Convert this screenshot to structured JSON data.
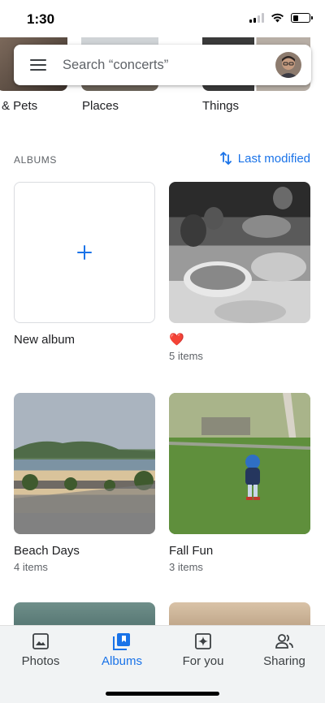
{
  "status": {
    "time": "1:30"
  },
  "search": {
    "placeholder": "Search “concerts”"
  },
  "categories": [
    {
      "label": "& Pets"
    },
    {
      "label": "Places"
    },
    {
      "label": "Things"
    }
  ],
  "albums_section": {
    "heading": "ALBUMS",
    "sort_label": "Last modified"
  },
  "albums": [
    {
      "title": "New album",
      "count": ""
    },
    {
      "title": "❤️",
      "count": "5 items"
    },
    {
      "title": "Beach Days",
      "count": "4 items"
    },
    {
      "title": "Fall Fun",
      "count": "3 items"
    }
  ],
  "nav": [
    {
      "label": "Photos",
      "icon": "photo-icon"
    },
    {
      "label": "Albums",
      "icon": "albums-icon"
    },
    {
      "label": "For you",
      "icon": "sparkle-icon"
    },
    {
      "label": "Sharing",
      "icon": "people-icon"
    }
  ],
  "colors": {
    "accent": "#1a73e8",
    "text": "#202124",
    "secondary": "#5f6368"
  }
}
